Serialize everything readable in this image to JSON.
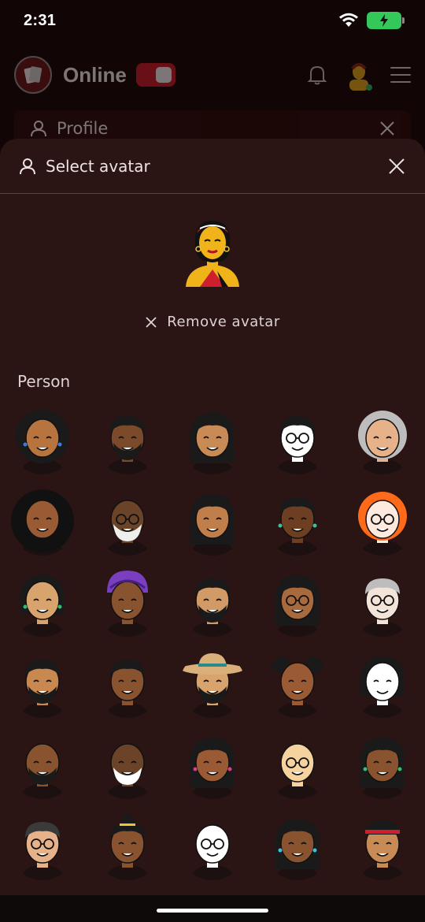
{
  "status_bar": {
    "time": "2:31"
  },
  "app": {
    "online_label": "Online",
    "logo_text": "Hand",
    "profile_label": "Profile"
  },
  "sheet": {
    "title": "Select avatar",
    "remove_label": "Remove avatar",
    "section_label": "Person"
  },
  "avatars": [
    {
      "skin": "#b8743f",
      "hair": "#1a1a1a",
      "style": "afro",
      "acc": "#3a7be0"
    },
    {
      "skin": "#7a4a2a",
      "hair": "#1a1a1a",
      "style": "locs",
      "beard": "#1a1a1a"
    },
    {
      "skin": "#c98b55",
      "hair": "#1a1a1a",
      "style": "long"
    },
    {
      "skin": "#ffffff",
      "hair": "#1a1a1a",
      "style": "short",
      "glasses": true
    },
    {
      "skin": "#e7b28a",
      "hair": "#bdbdbd",
      "style": "curly"
    },
    {
      "skin": "#9a5a33",
      "hair": "#111111",
      "style": "bigafro"
    },
    {
      "skin": "#6b4329",
      "hair": "#6b4329",
      "style": "bald",
      "beard": "#eeeeee",
      "glasses": true
    },
    {
      "skin": "#c07e4a",
      "hair": "#1a1a1a",
      "style": "braids"
    },
    {
      "skin": "#6e3e22",
      "hair": "#1a1a1a",
      "style": "cornrows",
      "acc": "#3ec0a0"
    },
    {
      "skin": "#fde9dd",
      "hair": "#ff6a1a",
      "style": "curly",
      "glasses": true
    },
    {
      "skin": "#d9a36d",
      "hair": "#1a1a1a",
      "style": "bob",
      "acc": "#2fbf6e"
    },
    {
      "skin": "#8a5330",
      "hair": "#7a3fc0",
      "style": "wrap"
    },
    {
      "skin": "#d19a66",
      "hair": "#1a1a1a",
      "style": "fade",
      "beard": "#1a1a1a"
    },
    {
      "skin": "#a8693d",
      "hair": "#1a1a1a",
      "style": "braids",
      "glasses": true
    },
    {
      "skin": "#f3e3d8",
      "hair": "#bdbdbd",
      "style": "short",
      "glasses": true
    },
    {
      "skin": "#c8884f",
      "hair": "#1a1a1a",
      "style": "curlytop",
      "beard": "#1a1a1a"
    },
    {
      "skin": "#8a5330",
      "hair": "#1a1a1a",
      "style": "curlytop"
    },
    {
      "skin": "#d9a36d",
      "hair": "#d9b07a",
      "style": "hat",
      "beard": "#1a1a1a"
    },
    {
      "skin": "#9a5a33",
      "hair": "#1a1a1a",
      "style": "puffs"
    },
    {
      "skin": "#ffffff",
      "hair": "#1a1a1a",
      "style": "bob"
    },
    {
      "skin": "#8a5330",
      "hair": "#8a5330",
      "style": "bald",
      "beard": "#1a1a1a"
    },
    {
      "skin": "#6b4329",
      "hair": "#ffffff",
      "style": "bald",
      "beard": "#ffffff"
    },
    {
      "skin": "#9a5a33",
      "hair": "#1a1a1a",
      "style": "long",
      "acc": "#e03a8a"
    },
    {
      "skin": "#f6d39e",
      "hair": "#f6d39e",
      "style": "bald",
      "glasses": true
    },
    {
      "skin": "#8a5330",
      "hair": "#1a1a1a",
      "style": "braids",
      "acc": "#2fbf6e"
    },
    {
      "skin": "#e7b28a",
      "hair": "#3a3a3a",
      "style": "short",
      "glasses": true
    },
    {
      "skin": "#8a5330",
      "hair": "#1a1a1a",
      "style": "bun",
      "acc": "#f0c23a"
    },
    {
      "skin": "#ffffff",
      "hair": "#444444",
      "style": "bald",
      "glasses": true
    },
    {
      "skin": "#8a5330",
      "hair": "#1a1a1a",
      "style": "braids",
      "acc": "#3ec0e0"
    },
    {
      "skin": "#c98b55",
      "hair": "#1a1a1a",
      "style": "cap",
      "acc": "#d01f2c"
    }
  ]
}
